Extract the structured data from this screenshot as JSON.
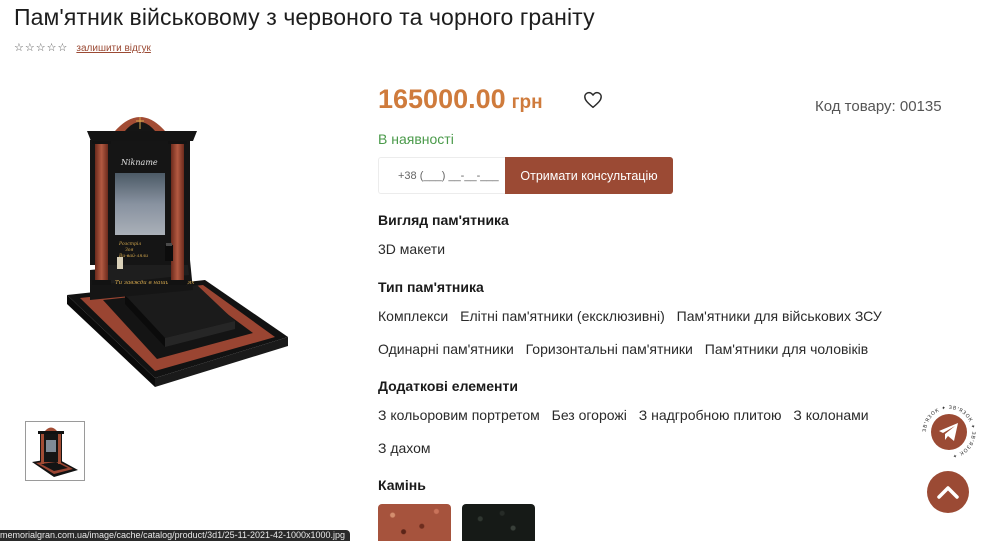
{
  "product": {
    "title": "Пам'ятник військовому з червоного та чорного граніту",
    "rating_stars": 0,
    "rating_max": 5,
    "review_link": "залишити відгук",
    "price_value": "165000.00",
    "price_currency": "грн",
    "sku": "Код товару: 00135",
    "stock": "В наявності",
    "image_text": {
      "plaque_name": "Nikname",
      "plaque_line1": "Розстріл",
      "plaque_line2": "Зоя",
      "plaque_line3": "Ви-вай-ляли",
      "base_inscription": "Ти завжди в наших серцях"
    }
  },
  "consult": {
    "phone_placeholder": "+38 (___) __-__-___",
    "button_label": "Отримати консультацію"
  },
  "sections": {
    "view_title": "Вигляд пам'ятника",
    "view_tags": [
      "3D макети"
    ],
    "type_title": "Тип пам'ятника",
    "type_tags_row1": [
      "Комплекси",
      "Елітні пам'ятники (ексклюзивні)",
      "Пам'ятники для військових ЗСУ"
    ],
    "type_tags_row2": [
      "Одинарні пам'ятники",
      "Горизонтальні пам'ятники",
      "Пам'ятники для чоловіків"
    ],
    "extras_title": "Додаткові елементи",
    "extras_tags_row1": [
      "З кольоровим портретом",
      "Без огорожі",
      "З надгробною плитою",
      "З колонами"
    ],
    "extras_tags_row2": [
      "З дахом"
    ],
    "stone_title": "Камінь"
  },
  "stones": [
    {
      "name": "red-granite",
      "color": "#a6533d"
    },
    {
      "name": "black-granite",
      "color": "#161a17"
    }
  ],
  "colors": {
    "accent": "#9b4a34",
    "price": "#cf7b3c",
    "stock": "#4a9a4a"
  },
  "widget": {
    "telegram_ring_text": "ЗВ'ЯЗОК ✦ ЗВ'ЯЗОК ✦ ЗВ'ЯЗОК ✦ "
  },
  "status_bar": {
    "url": "memorialgran.com.ua/image/cache/catalog/product/3d1/25-11-2021-42-1000x1000.jpg"
  }
}
